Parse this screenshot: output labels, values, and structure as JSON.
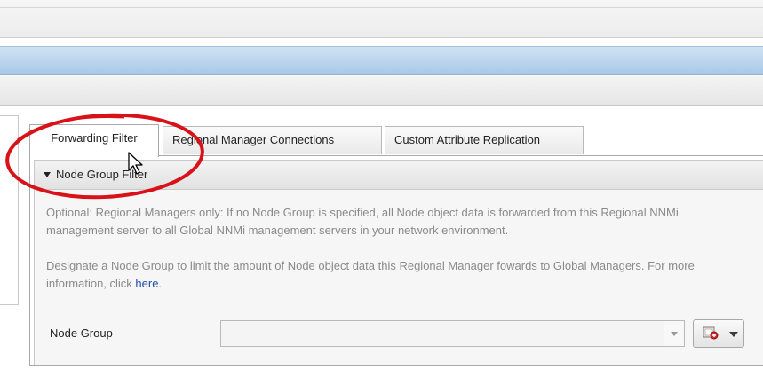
{
  "tabs": [
    {
      "label": "Forwarding Filter",
      "active": true
    },
    {
      "label": "Regional Manager Connections",
      "active": false
    },
    {
      "label": "Custom Attribute Replication",
      "active": false
    }
  ],
  "section": {
    "title": "Node Group Filter",
    "paragraph1": "Optional: Regional Managers only: If no Node Group is specified, all Node object data is forwarded from this Regional NNMi management server to all Global NNMi management servers in your network environment.",
    "paragraph2_text": "Designate a Node Group to limit the amount of Node object data this Regional Manager fowards to Global Managers. For more information, click ",
    "paragraph2_link": "here",
    "paragraph2_end": "."
  },
  "node_group": {
    "label": "Node Group",
    "value": ""
  },
  "icons": {
    "collapse": "triangle-down-icon",
    "select_arrow": "chevron-down-icon",
    "lookup": "node-lookup-icon",
    "cursor": "mouse-pointer-icon"
  },
  "colors": {
    "annotation": "#d9121a",
    "link": "#1f4fa8",
    "header_blue": "#b8d3ee"
  }
}
